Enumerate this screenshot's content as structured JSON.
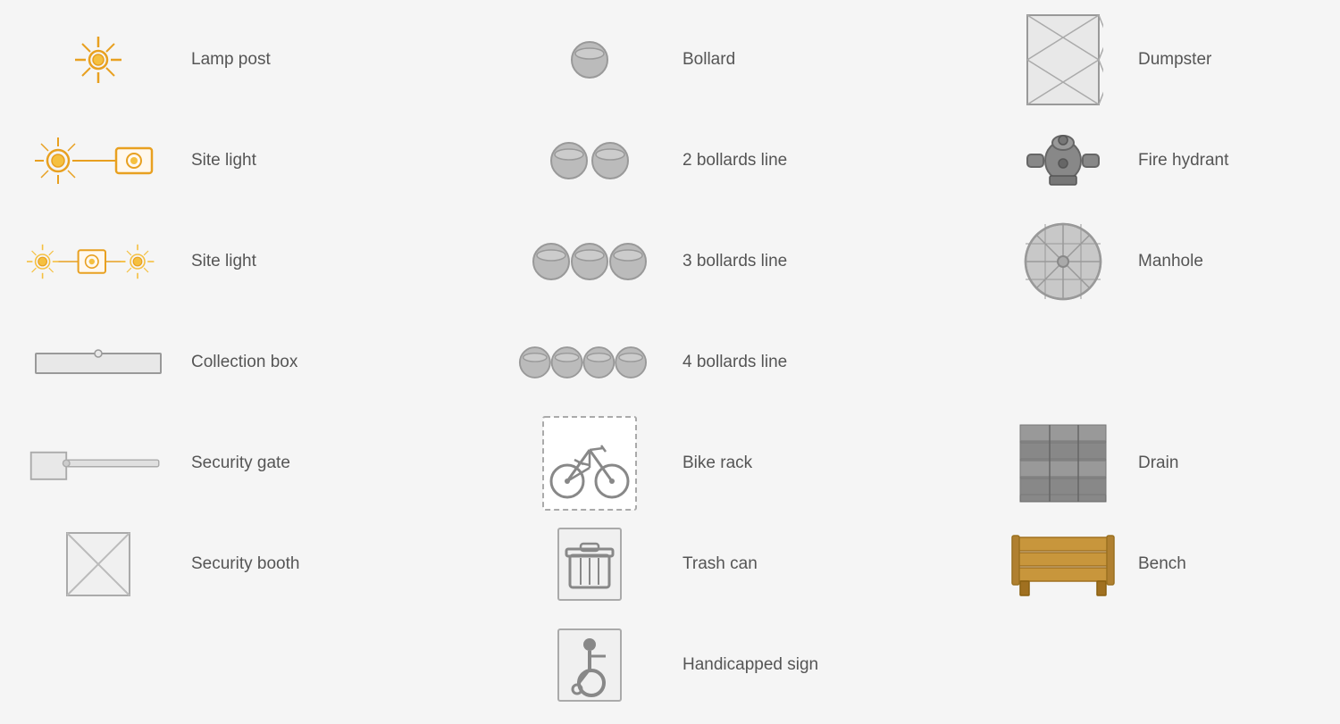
{
  "items": [
    {
      "id": "lamp-post",
      "label": "Lamp post"
    },
    {
      "id": "site-light-single",
      "label": "Site light"
    },
    {
      "id": "site-light-double",
      "label": "Site light"
    },
    {
      "id": "collection-box",
      "label": "Collection box"
    },
    {
      "id": "security-gate",
      "label": "Security gate"
    },
    {
      "id": "security-booth",
      "label": "Security booth"
    },
    {
      "id": "bollard",
      "label": "Bollard"
    },
    {
      "id": "bollard-2",
      "label": "2 bollards line"
    },
    {
      "id": "bollard-3",
      "label": "3 bollards line"
    },
    {
      "id": "bollard-4",
      "label": "4 bollards line"
    },
    {
      "id": "bike-rack",
      "label": "Bike rack"
    },
    {
      "id": "trash-can",
      "label": "Trash can"
    },
    {
      "id": "handicapped-sign",
      "label": "Handicapped sign"
    },
    {
      "id": "dumpster",
      "label": "Dumpster"
    },
    {
      "id": "fire-hydrant",
      "label": "Fire hydrant"
    },
    {
      "id": "manhole",
      "label": "Manhole"
    },
    {
      "id": "drain",
      "label": "Drain"
    },
    {
      "id": "bench",
      "label": "Bench"
    }
  ]
}
